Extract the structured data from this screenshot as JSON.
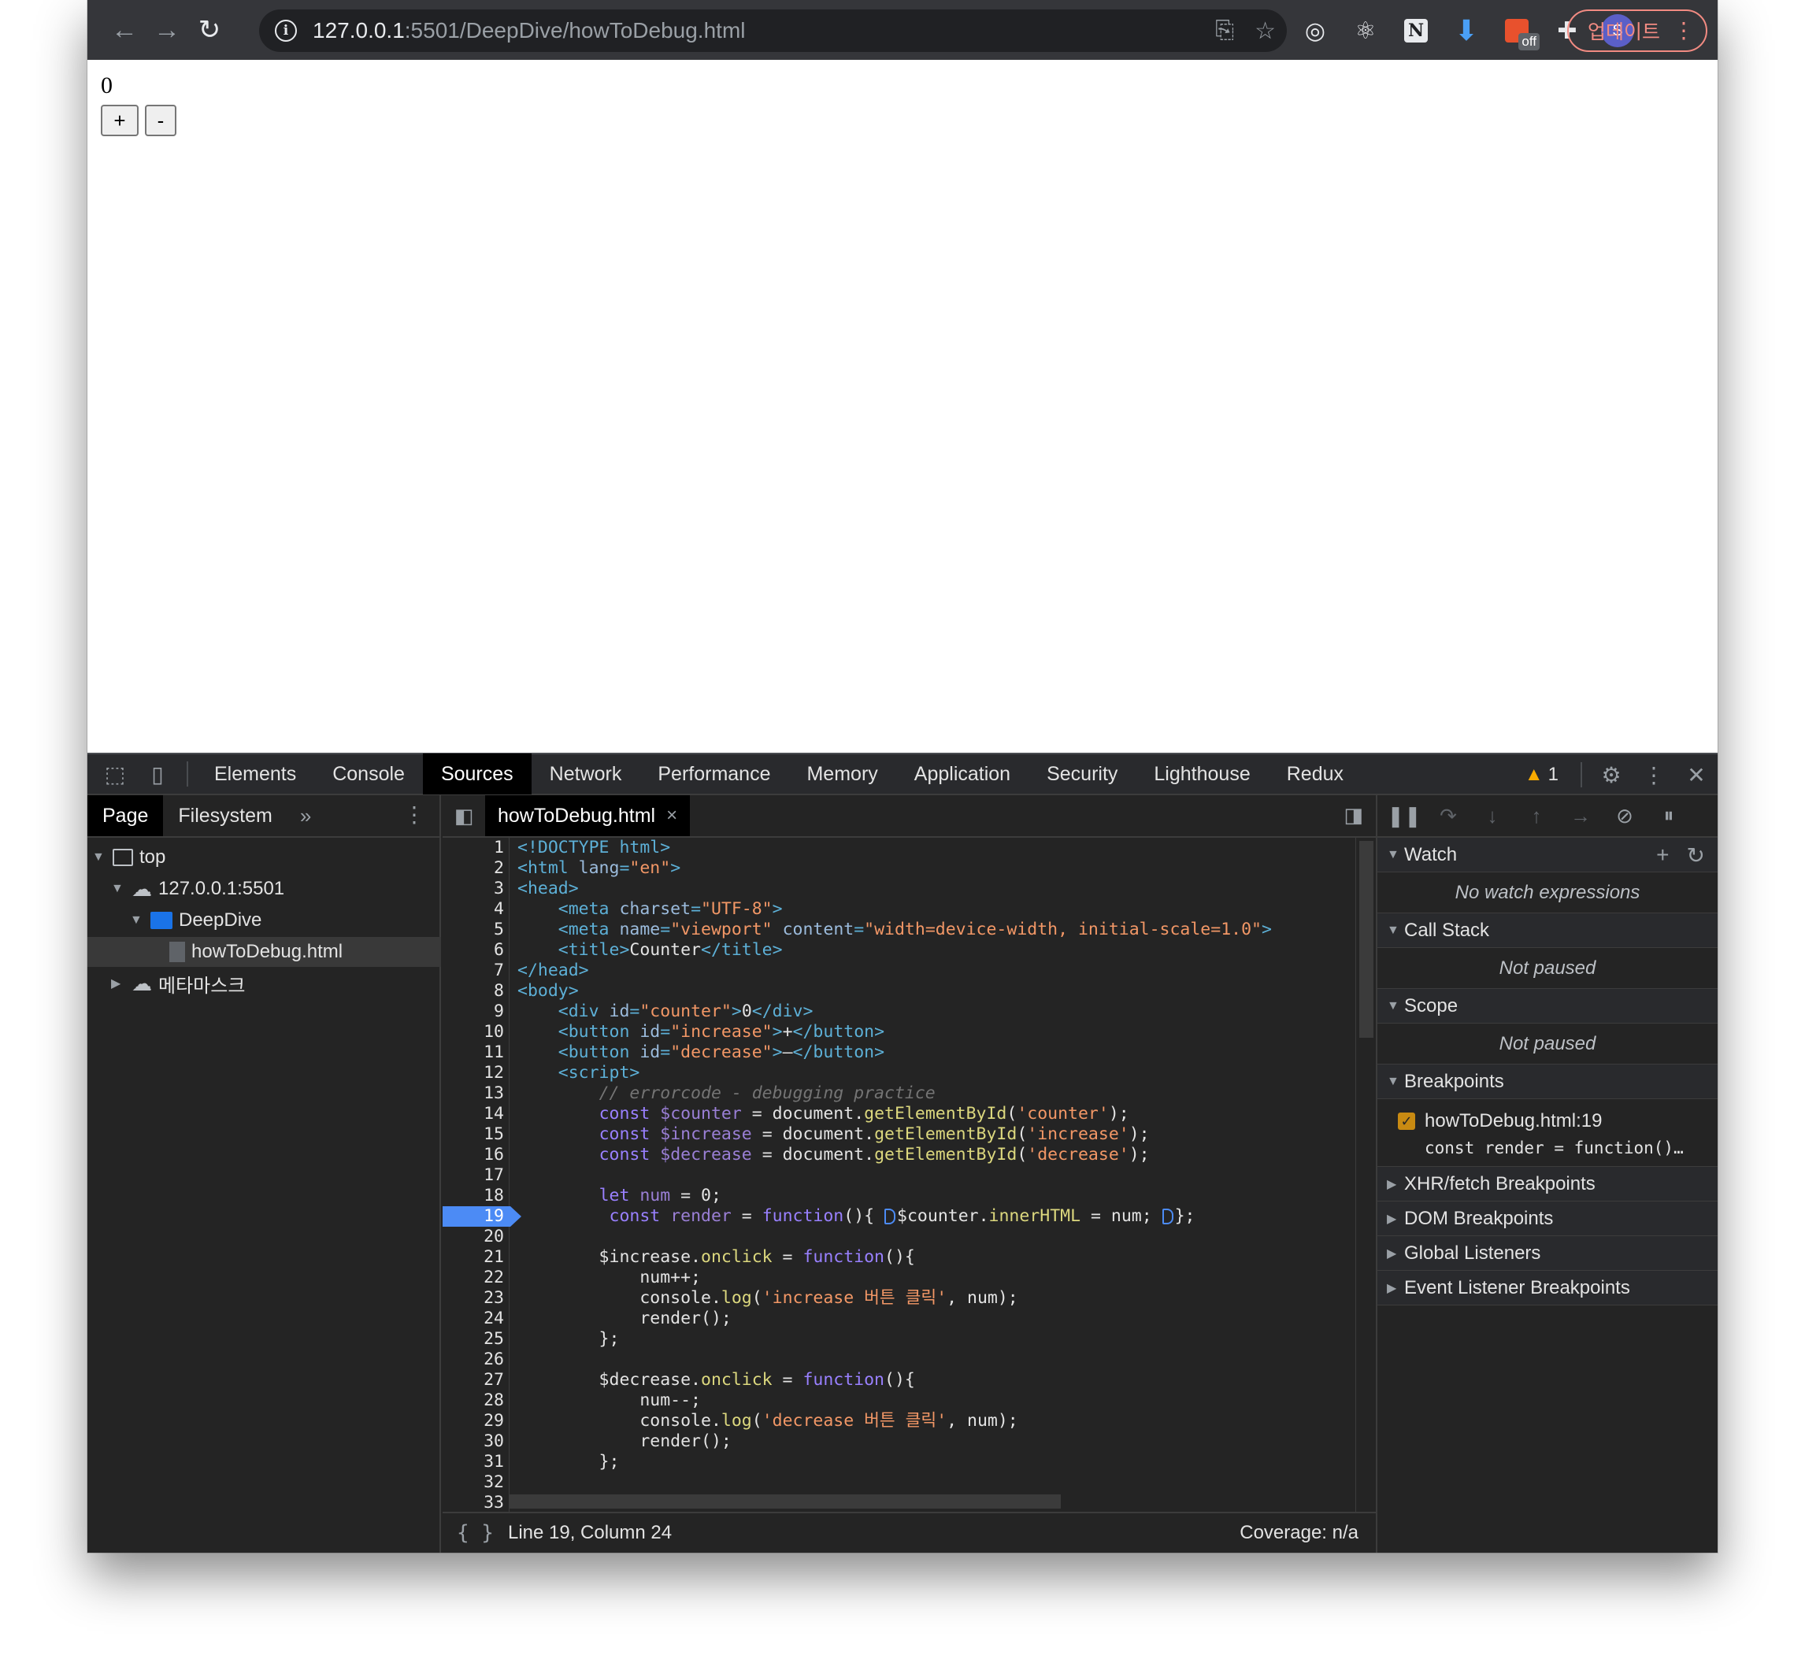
{
  "browser": {
    "url_host": "127.0.0.1",
    "url_path": ":5501/DeepDive/howToDebug.html",
    "update_label": "업데이트",
    "avatar_letter": "S",
    "off_badge": "off"
  },
  "page": {
    "counter_value": "0",
    "increase_label": "+",
    "decrease_label": "-"
  },
  "devtools": {
    "tabs": [
      "Elements",
      "Console",
      "Sources",
      "Network",
      "Performance",
      "Memory",
      "Application",
      "Security",
      "Lighthouse",
      "Redux"
    ],
    "active_tab": "Sources",
    "warning_count": "1",
    "navigator": {
      "tabs": [
        "Page",
        "Filesystem"
      ],
      "more": "»",
      "tree": {
        "top": "top",
        "host": "127.0.0.1:5501",
        "folder": "DeepDive",
        "file": "howToDebug.html",
        "metamask": "메타마스크"
      }
    },
    "editor": {
      "file_tab": "howToDebug.html",
      "close": "×",
      "status_position": "Line 19, Column 24",
      "coverage": "Coverage: n/a",
      "braces": "{ }",
      "breakpoint_line": 19,
      "line_numbers": [
        "1",
        "2",
        "3",
        "4",
        "5",
        "6",
        "7",
        "8",
        "9",
        "10",
        "11",
        "12",
        "13",
        "14",
        "15",
        "16",
        "17",
        "18",
        "19",
        "20",
        "21",
        "22",
        "23",
        "24",
        "25",
        "26",
        "27",
        "28",
        "29",
        "30",
        "31",
        "32",
        "33"
      ]
    },
    "debugger": {
      "watch": {
        "title": "Watch",
        "empty": "No watch expressions"
      },
      "call_stack": {
        "title": "Call Stack",
        "empty": "Not paused"
      },
      "scope": {
        "title": "Scope",
        "empty": "Not paused"
      },
      "breakpoints": {
        "title": "Breakpoints",
        "file": "howToDebug.html:19",
        "code": "const render = function()…"
      },
      "collapsed_sections": [
        "XHR/fetch Breakpoints",
        "DOM Breakpoints",
        "Global Listeners",
        "Event Listener Breakpoints"
      ]
    },
    "colors": {
      "breakpoint_blue": "#4c8bf5",
      "active_tab_bg": "#000000",
      "warning_yellow": "#f9ab00",
      "checkbox_orange": "#c88a12"
    }
  },
  "icons": [
    "back-arrow-icon",
    "forward-arrow-icon",
    "reload-icon",
    "info-icon",
    "translate-icon",
    "star-icon",
    "target-icon",
    "react-icon",
    "notion-icon",
    "download-icon",
    "puzzle-icon",
    "inspect-icon",
    "device-toggle-icon",
    "gear-icon",
    "kebab-icon",
    "close-icon",
    "pause-icon",
    "step-over-icon",
    "step-into-icon",
    "step-out-icon",
    "step-icon",
    "deactivate-breakpoints-icon",
    "pause-on-exceptions-icon",
    "plus-icon",
    "refresh-icon"
  ]
}
